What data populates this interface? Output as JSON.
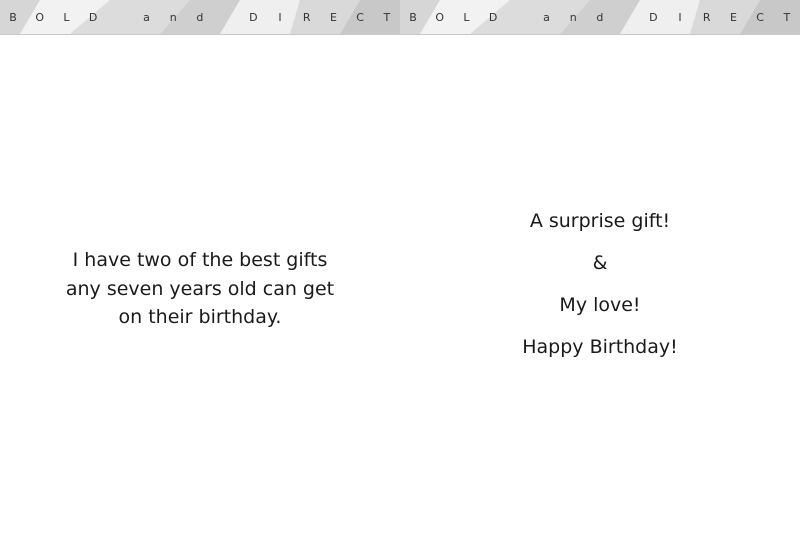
{
  "banner": {
    "letters": [
      "B",
      "O",
      "L",
      "D",
      " ",
      "a",
      "n",
      "d",
      " ",
      "D",
      "I",
      "R",
      "E",
      "C",
      "T"
    ]
  },
  "left_panel": {
    "line1": "I have two of the best gifts",
    "line2": "any seven years old can get",
    "line3": "on their birthday."
  },
  "right_panel": {
    "line1": "A surprise gift!",
    "line2": "&",
    "line3": "My love!",
    "line4": "Happy Birthday!"
  }
}
